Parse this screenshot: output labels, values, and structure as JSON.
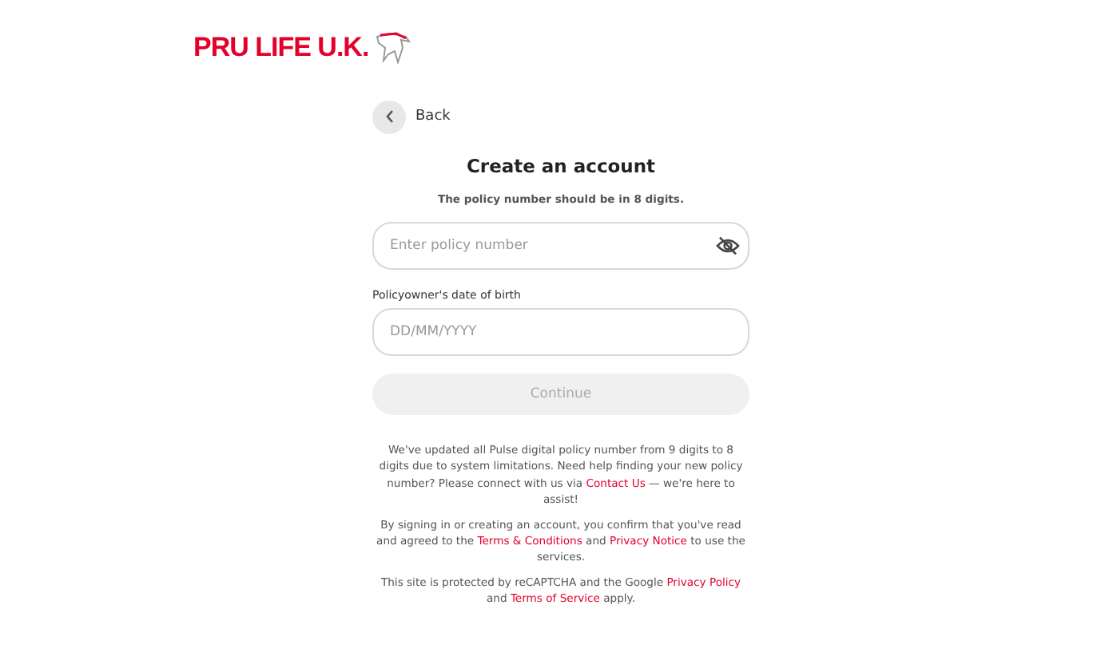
{
  "logo": {
    "text": "PRU LIFE U.K."
  },
  "back": {
    "label": "Back"
  },
  "title": "Create an account",
  "hint": "The policy number should be in 8 digits.",
  "fields": [
    {
      "placeholder": "Enter policy number",
      "visibility_toggle": true
    },
    {
      "label": "Policyowner's date of birth",
      "placeholder": "DD/MM/YYYY",
      "visibility_toggle": false
    }
  ],
  "continue": {
    "label": "Continue",
    "disabled": true
  },
  "notes": [
    [
      {
        "text": "We've updated all Pulse digital policy number from 9 digits to 8 digits due to system limitations. Need help finding your new policy number? Please connect with us via ",
        "link": false
      },
      {
        "text": "Contact Us",
        "link": true
      },
      {
        "text": " — we're here to assist!",
        "link": false
      }
    ],
    [
      {
        "text": "By signing in or creating an account, you confirm that you've read and agreed to the ",
        "link": false
      },
      {
        "text": "Terms & Conditions",
        "link": true
      },
      {
        "text": " and ",
        "link": false
      },
      {
        "text": "Privacy Notice",
        "link": true
      },
      {
        "text": " to use the services.",
        "link": false
      }
    ],
    [
      {
        "text": "This site is protected by reCAPTCHA and the Google ",
        "link": false
      },
      {
        "text": "Privacy Policy",
        "link": true
      },
      {
        "text": " and ",
        "link": false
      },
      {
        "text": "Terms of Service",
        "link": true
      },
      {
        "text": " apply.",
        "link": false
      }
    ]
  ]
}
